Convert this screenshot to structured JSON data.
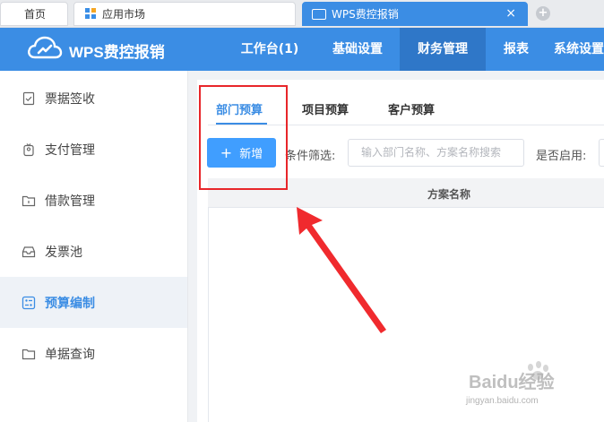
{
  "browser": {
    "tabs": [
      {
        "label": "首页"
      },
      {
        "label": "应用市场"
      },
      {
        "label": "WPS费控报销",
        "active": true
      }
    ],
    "close_glyph": "×",
    "new_tab_glyph": "+"
  },
  "header": {
    "brand": "WPS费控报销",
    "nav": [
      {
        "label": "工作台(1)"
      },
      {
        "label": "基础设置"
      },
      {
        "label": "财务管理",
        "active": true
      },
      {
        "label": "报表"
      },
      {
        "label": "系统设置"
      }
    ]
  },
  "sidebar": {
    "items": [
      {
        "label": "票据签收",
        "icon": "receipt-check-icon"
      },
      {
        "label": "支付管理",
        "icon": "payment-icon"
      },
      {
        "label": "借款管理",
        "icon": "loan-folder-icon"
      },
      {
        "label": "发票池",
        "icon": "invoice-pool-icon"
      },
      {
        "label": "预算编制",
        "icon": "budget-icon",
        "active": true
      },
      {
        "label": "单据查询",
        "icon": "folder-icon"
      }
    ]
  },
  "main": {
    "tabs": [
      {
        "label": "部门预算",
        "active": true
      },
      {
        "label": "项目预算"
      },
      {
        "label": "客户预算"
      }
    ],
    "add_button": {
      "icon": "+",
      "label": "新增"
    },
    "filter_label": "条件筛选:",
    "search_placeholder": "输入部门名称、方案名称搜索",
    "enabled_label": "是否启用:",
    "table": {
      "columns": [
        "方案名称"
      ],
      "rows": []
    }
  },
  "watermark": {
    "brand": "Baidu经验",
    "url": "jingyan.baidu.com"
  },
  "colors": {
    "primary": "#3b8de4",
    "button": "#409eff",
    "annotation": "#e8262a"
  }
}
